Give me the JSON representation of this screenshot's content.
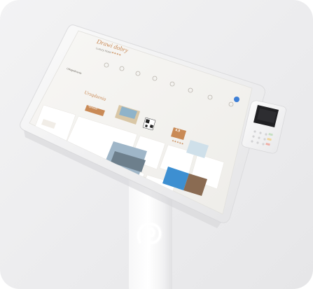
{
  "screen": {
    "welcome_script": "Drawi dobry",
    "hotel_name": "Luxury Hotel",
    "stars": "★★★★",
    "section_label": "Udogodnienia",
    "promo_script": "Urządzenia",
    "promo_button": "Sprawdź",
    "rating_value": "4.9",
    "rating_stars": "★★★★★"
  },
  "colors": {
    "accent": "#c98a56",
    "screen_bg": "#f6f5f3",
    "card_bg": "#ffffff",
    "blue_badge": "#3e7fd6"
  },
  "icons": [
    "stand-logo-icon",
    "qr-code-icon",
    "payment-terminal-icon"
  ]
}
